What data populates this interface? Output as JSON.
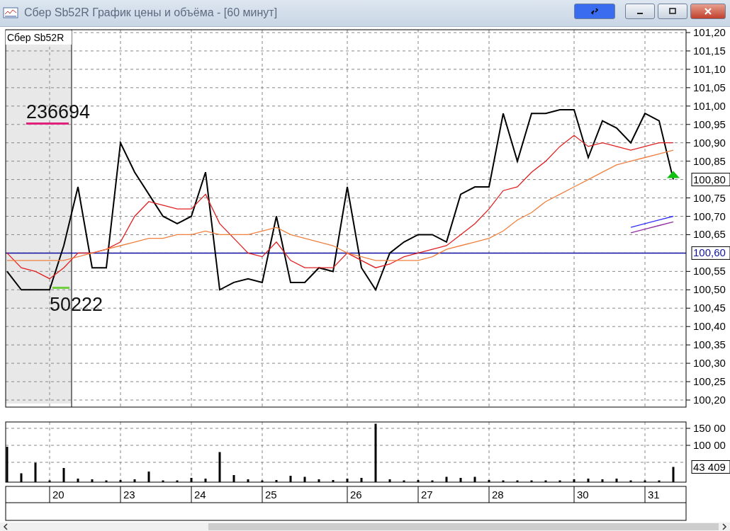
{
  "window": {
    "title": "Сбер Sb52R График цены и объёма - [60 минут]",
    "buttons": [
      {
        "kind": "link"
      },
      {
        "kind": "minimize"
      },
      {
        "kind": "maximize"
      },
      {
        "kind": "close"
      }
    ]
  },
  "price_chart": {
    "instrument": "Сбер Sb52R",
    "order_book": [
      {
        "kind": "ask",
        "text": "236694"
      },
      {
        "kind": "bid",
        "text": "50222"
      }
    ],
    "last_label": "100,80",
    "chart_data": {
      "type": "line",
      "grid": true,
      "ylim": [
        100.2,
        101.2
      ],
      "yticks": [
        {
          "value": 100.2,
          "label": "100,20"
        },
        {
          "value": 100.25,
          "label": "100,25"
        },
        {
          "value": 100.3,
          "label": "100,30"
        },
        {
          "value": 100.35,
          "label": "100,35"
        },
        {
          "value": 100.4,
          "label": "100,40"
        },
        {
          "value": 100.45,
          "label": "100,45"
        },
        {
          "value": 100.5,
          "label": "100,50"
        },
        {
          "value": 100.55,
          "label": "100,55"
        },
        {
          "value": 100.65,
          "label": "100,65"
        },
        {
          "value": 100.7,
          "label": "100,70"
        },
        {
          "value": 100.75,
          "label": "100,75"
        },
        {
          "value": 100.85,
          "label": "100,85"
        },
        {
          "value": 100.9,
          "label": "100,90"
        },
        {
          "value": 100.95,
          "label": "100,95"
        },
        {
          "value": 101,
          "label": "101,00"
        },
        {
          "value": 101.05,
          "label": "101,05"
        },
        {
          "value": 101.1,
          "label": "101,10"
        },
        {
          "value": 101.15,
          "label": "101,15"
        },
        {
          "value": 101.2,
          "label": "101,20"
        }
      ],
      "ref_lines": [
        {
          "axis": "y",
          "value": 100.6,
          "label": "100,60",
          "color": "#1010a0"
        }
      ],
      "series": [
        {
          "color": "#000000",
          "values": [
            100.55,
            100.5,
            100.5,
            100.5,
            100.62,
            100.78,
            100.56,
            100.56,
            100.9,
            100.82,
            100.76,
            100.7,
            100.68,
            100.7,
            100.82,
            100.5,
            100.52,
            100.53,
            100.52,
            100.7,
            100.52,
            100.52,
            100.56,
            100.55,
            100.78,
            100.56,
            100.5,
            100.6,
            100.63,
            100.65,
            100.65,
            100.63,
            100.76,
            100.78,
            100.78,
            100.98,
            100.85,
            100.98,
            100.98,
            100.99,
            100.99,
            100.86,
            100.96,
            100.94,
            100.9,
            100.98,
            100.96,
            100.8
          ]
        },
        {
          "color": "#e02020",
          "values": [
            100.6,
            100.56,
            100.55,
            100.53,
            100.56,
            100.6,
            100.6,
            100.61,
            100.63,
            100.7,
            100.74,
            100.73,
            100.72,
            100.72,
            100.76,
            100.68,
            100.64,
            100.6,
            100.59,
            100.63,
            100.58,
            100.56,
            100.56,
            100.56,
            100.6,
            100.58,
            100.56,
            100.57,
            100.59,
            100.6,
            100.61,
            100.62,
            100.65,
            100.68,
            100.72,
            100.77,
            100.78,
            100.82,
            100.85,
            100.89,
            100.92,
            100.89,
            100.9,
            100.89,
            100.88,
            100.89,
            100.9,
            100.9
          ]
        },
        {
          "color": "#f08040",
          "values": [
            100.58,
            100.58,
            100.58,
            100.58,
            100.58,
            100.59,
            100.6,
            100.61,
            100.62,
            100.63,
            100.64,
            100.64,
            100.65,
            100.65,
            100.66,
            100.65,
            100.65,
            100.65,
            100.66,
            100.67,
            100.65,
            100.64,
            100.63,
            100.62,
            100.6,
            100.59,
            100.58,
            100.58,
            100.58,
            100.58,
            100.59,
            100.61,
            100.62,
            100.63,
            100.64,
            100.66,
            100.69,
            100.71,
            100.74,
            100.76,
            100.78,
            100.8,
            100.82,
            100.84,
            100.85,
            100.86,
            100.87,
            100.88
          ]
        },
        {
          "color": "#3030ff",
          "values": [
            null,
            null,
            null,
            null,
            null,
            null,
            null,
            null,
            null,
            null,
            null,
            null,
            null,
            null,
            null,
            null,
            null,
            null,
            null,
            null,
            null,
            null,
            null,
            null,
            null,
            null,
            null,
            null,
            null,
            null,
            null,
            null,
            null,
            null,
            null,
            null,
            null,
            null,
            null,
            null,
            null,
            null,
            null,
            null,
            100.67,
            100.68,
            100.69,
            100.7
          ]
        },
        {
          "color": "#9030a0",
          "values": [
            null,
            null,
            null,
            null,
            null,
            null,
            null,
            null,
            null,
            null,
            null,
            null,
            null,
            null,
            null,
            null,
            null,
            null,
            null,
            null,
            null,
            null,
            null,
            null,
            null,
            null,
            null,
            null,
            null,
            null,
            null,
            null,
            null,
            null,
            null,
            null,
            null,
            null,
            null,
            null,
            null,
            null,
            null,
            null,
            100.655,
            100.665,
            100.675,
            100.685
          ]
        }
      ]
    }
  },
  "volume_chart": {
    "axis_labels": [
      "150 00",
      "100 00"
    ],
    "last_label": "43 409"
  },
  "date_axis": {
    "labels": [
      "20",
      "23",
      "24",
      "25",
      "26",
      "27",
      "28",
      "30",
      "31"
    ]
  }
}
